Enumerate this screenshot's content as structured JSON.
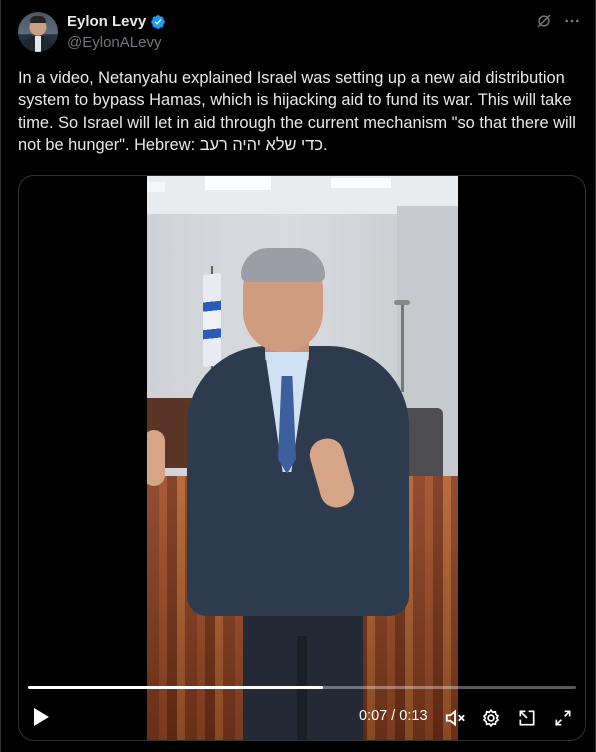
{
  "author": {
    "display_name": "Eylon Levy",
    "handle": "@EylonALevy",
    "verified_icon": "verified-badge-icon",
    "verified_color": "#1d9bf0"
  },
  "header_icons": [
    "grok-icon",
    "more-icon"
  ],
  "tweet": {
    "text": "In a video, Netanyahu explained Israel was setting up a new aid distribution system to bypass Hamas, which is hijacking aid to fund its war. This will take time. So Israel will let in aid through the current mechanism \"so that there will not be hunger\". Hebrew: כדי שלא יהיה רעב."
  },
  "video": {
    "time_display": "0:07 / 0:13",
    "progress_fraction": 0.538,
    "controls": [
      "play-icon",
      "mute-icon",
      "settings-icon",
      "pip-icon",
      "fullscreen-icon"
    ]
  },
  "colors": {
    "background": "#000000",
    "text_primary": "#e7e9ea",
    "text_secondary": "#71767b",
    "border": "#2f3336"
  }
}
